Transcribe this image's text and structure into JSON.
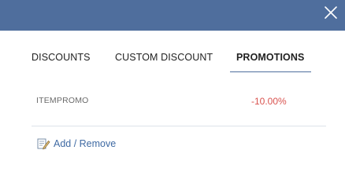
{
  "dialog": {
    "close_icon": "close-icon"
  },
  "tabs": [
    {
      "label": "DISCOUNTS",
      "active": false
    },
    {
      "label": "CUSTOM DISCOUNT",
      "active": false
    },
    {
      "label": "PROMOTIONS",
      "active": true
    }
  ],
  "promotions": [
    {
      "name": "ITEMPROMO",
      "value": "-10.00%"
    }
  ],
  "actions": {
    "add_remove_label": "Add / Remove",
    "add_remove_icon": "edit-icon"
  },
  "colors": {
    "header": "#4f6e9d",
    "active_tab_underline": "#4f6e9d",
    "promo_value": "#d9534f",
    "link": "#3f6aa3"
  }
}
